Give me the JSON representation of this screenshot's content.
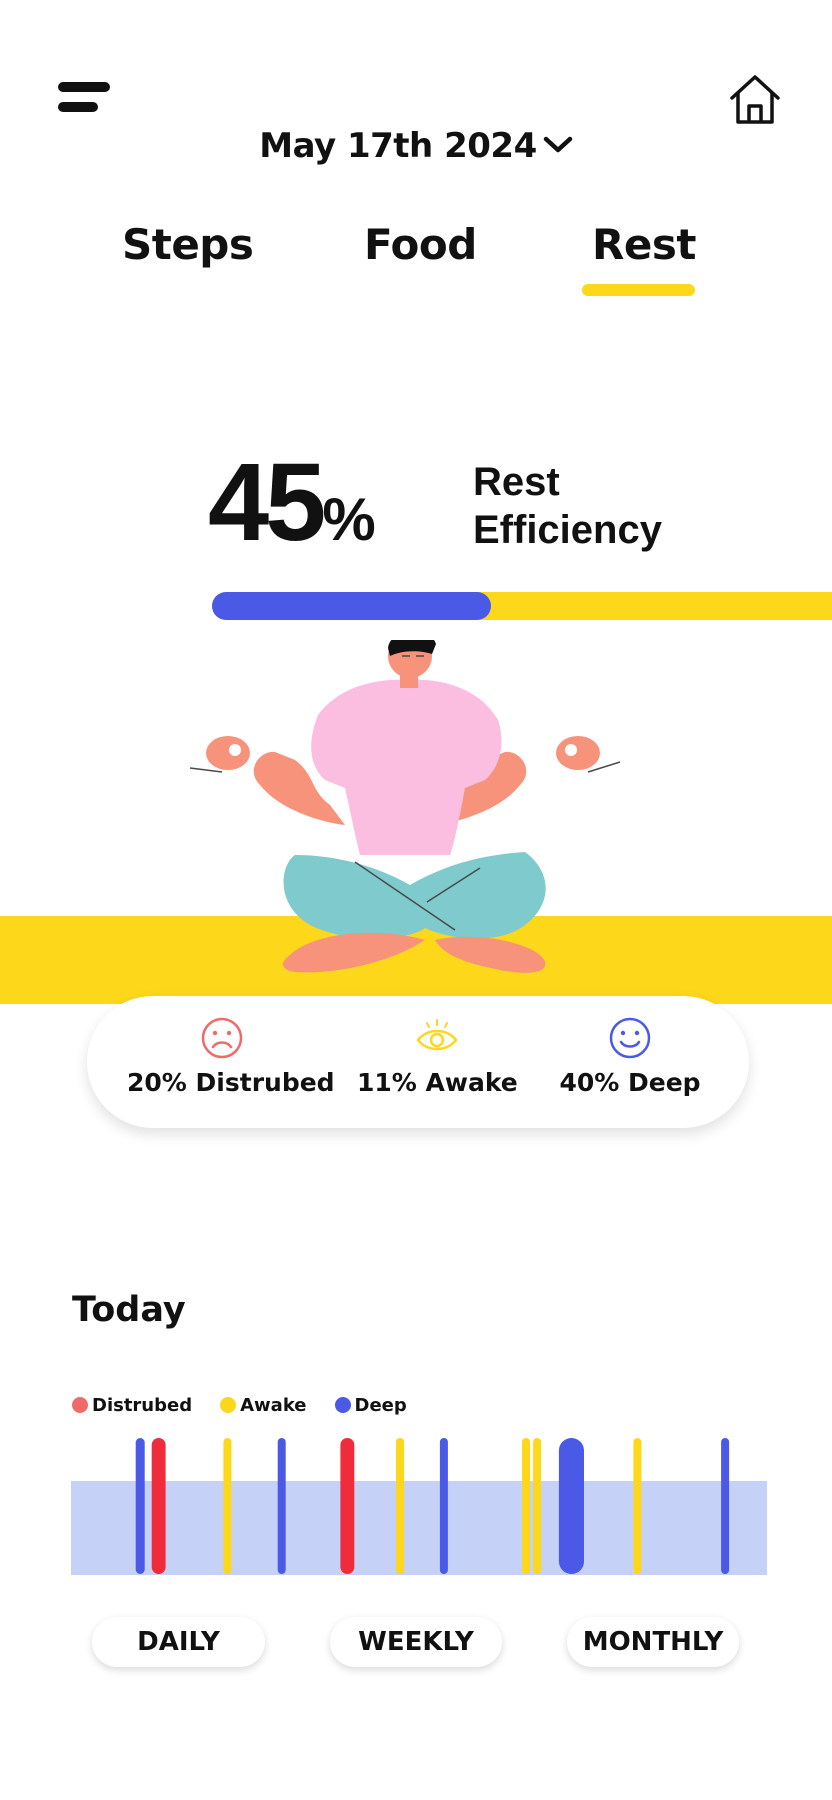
{
  "header": {
    "menu_icon": "menu-icon",
    "home_icon": "home-icon",
    "date": "May 17th 2024",
    "date_chevron_icon": "chevron-down-icon"
  },
  "tabs": [
    {
      "label": "Steps",
      "active": false
    },
    {
      "label": "Food",
      "active": false
    },
    {
      "label": "Rest",
      "active": true
    }
  ],
  "efficiency": {
    "value_number": "45",
    "value_unit": "%",
    "label_line1": "Rest",
    "label_line2": "Efficiency",
    "progress_fraction": 0.45
  },
  "stats": [
    {
      "icon": "sad-face-icon",
      "label": "20% Distrubed",
      "color": "#f16a6a"
    },
    {
      "icon": "eye-icon",
      "label": "11% Awake",
      "color": "#fdd71a"
    },
    {
      "icon": "smile-face-icon",
      "label": "40% Deep",
      "color": "#4a5ae6"
    }
  ],
  "today": {
    "title": "Today",
    "legend": [
      {
        "label": "Distrubed",
        "color": "#f16a6a"
      },
      {
        "label": "Awake",
        "color": "#fdd71a"
      },
      {
        "label": "Deep",
        "color": "#4a5ae6"
      }
    ],
    "timeline_events": [
      {
        "type": "Deep",
        "position": 0.093,
        "width": 0.013,
        "color": "#4a5ae6"
      },
      {
        "type": "Distrubed",
        "position": 0.116,
        "width": 0.02,
        "color": "#ef2b3c"
      },
      {
        "type": "Awake",
        "position": 0.219,
        "width": 0.008,
        "color": "#fdd71a"
      },
      {
        "type": "Deep",
        "position": 0.297,
        "width": 0.011,
        "color": "#4a5ae6"
      },
      {
        "type": "Distrubed",
        "position": 0.387,
        "width": 0.02,
        "color": "#ef2b3c"
      },
      {
        "type": "Awake",
        "position": 0.467,
        "width": 0.008,
        "color": "#fdd71a"
      },
      {
        "type": "Deep",
        "position": 0.53,
        "width": 0.011,
        "color": "#4a5ae6"
      },
      {
        "type": "Awake",
        "position": 0.648,
        "width": 0.008,
        "color": "#fdd71a"
      },
      {
        "type": "Awake",
        "position": 0.664,
        "width": 0.008,
        "color": "#fdd71a"
      },
      {
        "type": "Deep",
        "position": 0.701,
        "width": 0.036,
        "color": "#4a5ae6"
      },
      {
        "type": "Awake",
        "position": 0.808,
        "width": 0.008,
        "color": "#fdd71a"
      },
      {
        "type": "Deep",
        "position": 0.934,
        "width": 0.011,
        "color": "#4a5ae6"
      }
    ],
    "timeline_band_color": "#c6d1f7"
  },
  "period_buttons": [
    "DAILY",
    "WEEKLY",
    "MONTHLY"
  ],
  "colors": {
    "accent_yellow": "#fdd71a",
    "deep_blue": "#4a5ae6",
    "disturbed_red": "#f16a6a"
  }
}
